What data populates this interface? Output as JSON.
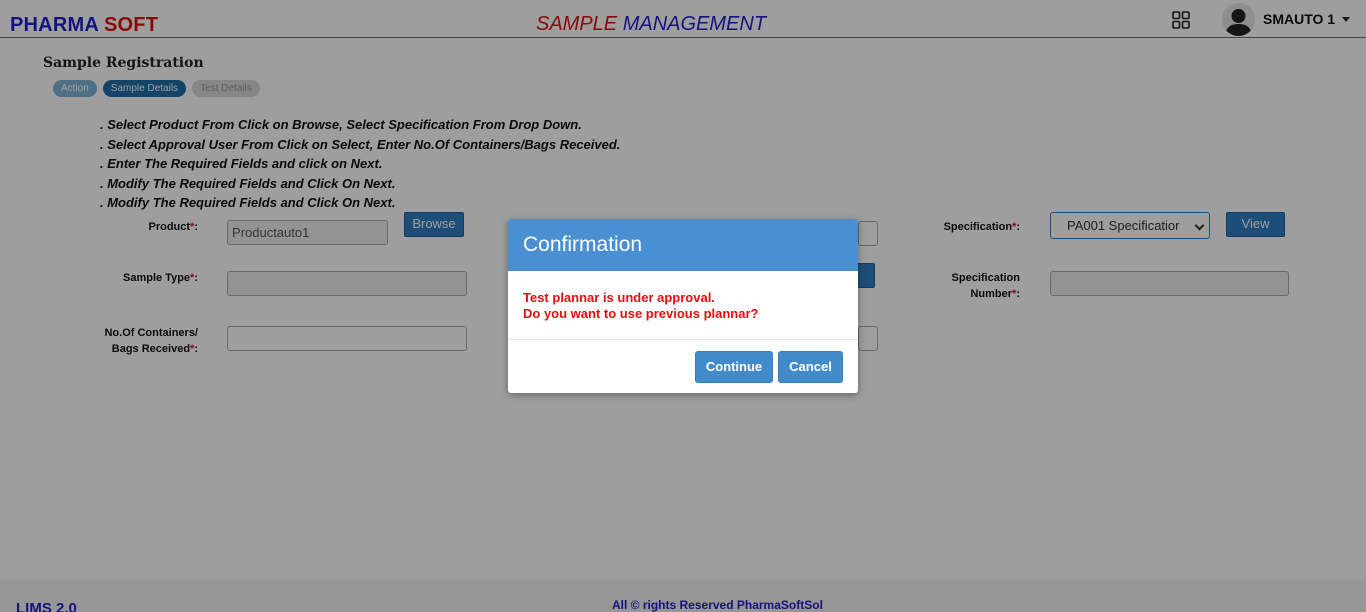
{
  "header": {
    "brand_part1": "PHARMA",
    "brand_part2": "SOFT",
    "title_part1": "SAMPLE",
    "title_part2": "MANAGEMENT",
    "apps_icon": "grid-icon",
    "user_name": "SMAUTO 1"
  },
  "page": {
    "title": "Sample Registration",
    "steps": [
      "Action",
      "Sample Details",
      "Test Details"
    ],
    "active_step": "Sample Details",
    "instructions": [
      ". Select Product From Click on Browse, Select Specification From Drop Down.",
      ". Select Approval User From Click on Select, Enter No.Of Containers/Bags Received.",
      ". Enter The Required Fields and click on Next.",
      ". Modify The Required Fields and Click On Next.",
      ". Modify The Required Fields and Click On Next."
    ]
  },
  "form": {
    "product_label": "Product",
    "product_value": "Productauto1",
    "browse_label": "Browse",
    "sample_type_label": "Sample Type",
    "containers_label_line1": "No.Of Containers/",
    "containers_label_line2": "Bags Received",
    "specification_label": "Specification",
    "specification_value": "PA001 Specificatior",
    "view_label": "View",
    "spec_number_label_line1": "Specification",
    "spec_number_label_line2": "Number",
    "required_mark": "*",
    "label_suffix": ":"
  },
  "modal": {
    "title": "Confirmation",
    "message_line1": "Test plannar is under approval.",
    "message_line2": "Do you want to use previous plannar?",
    "continue_label": "Continue",
    "cancel_label": "Cancel"
  },
  "footer": {
    "version": "LIMS 2.0",
    "copyright": "All © rights Reserved PharmaSoftSol"
  },
  "colors": {
    "brand_blue": "#1f1fd1",
    "brand_red": "#e01010",
    "primary_button": "#2f7fc1",
    "modal_header": "#4a8fd1"
  }
}
